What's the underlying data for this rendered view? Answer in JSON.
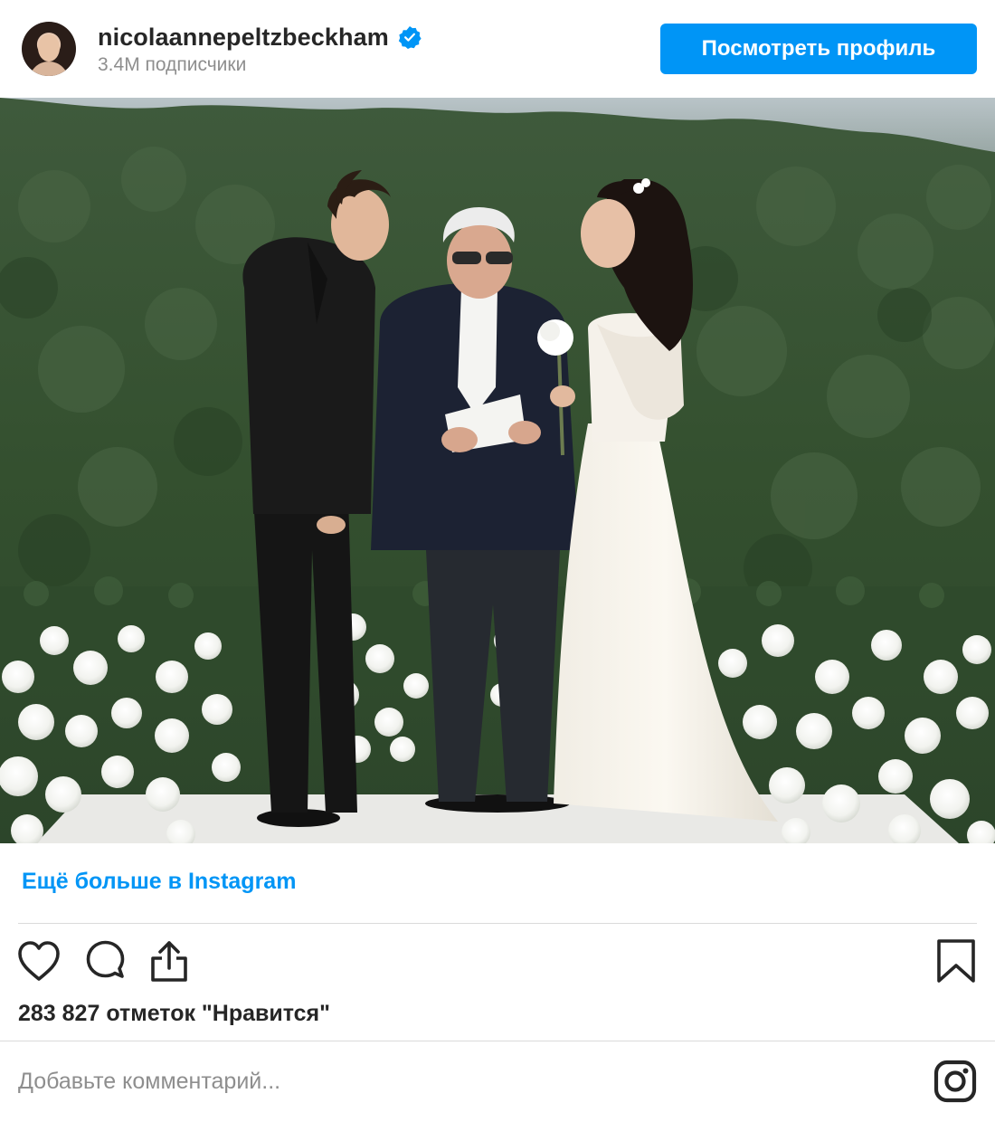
{
  "header": {
    "username": "nicolaannepeltzbeckham",
    "verified": true,
    "followers": "3.4M подписчики",
    "view_profile_label": "Посмотреть профиль"
  },
  "post": {
    "image_alt": "Фото"
  },
  "more_link": "Ещё больше в Instagram",
  "actions": {
    "like_icon": "heart-icon",
    "comment_icon": "comment-icon",
    "share_icon": "share-icon",
    "save_icon": "bookmark-icon"
  },
  "likes_text": "283 827 отметок \"Нравится\"",
  "comment": {
    "placeholder": "Добавьте комментарий...",
    "value": ""
  },
  "colors": {
    "accent": "#0095f6",
    "text": "#262626",
    "muted": "#8e8e8e",
    "divider": "#dbdbdb"
  }
}
